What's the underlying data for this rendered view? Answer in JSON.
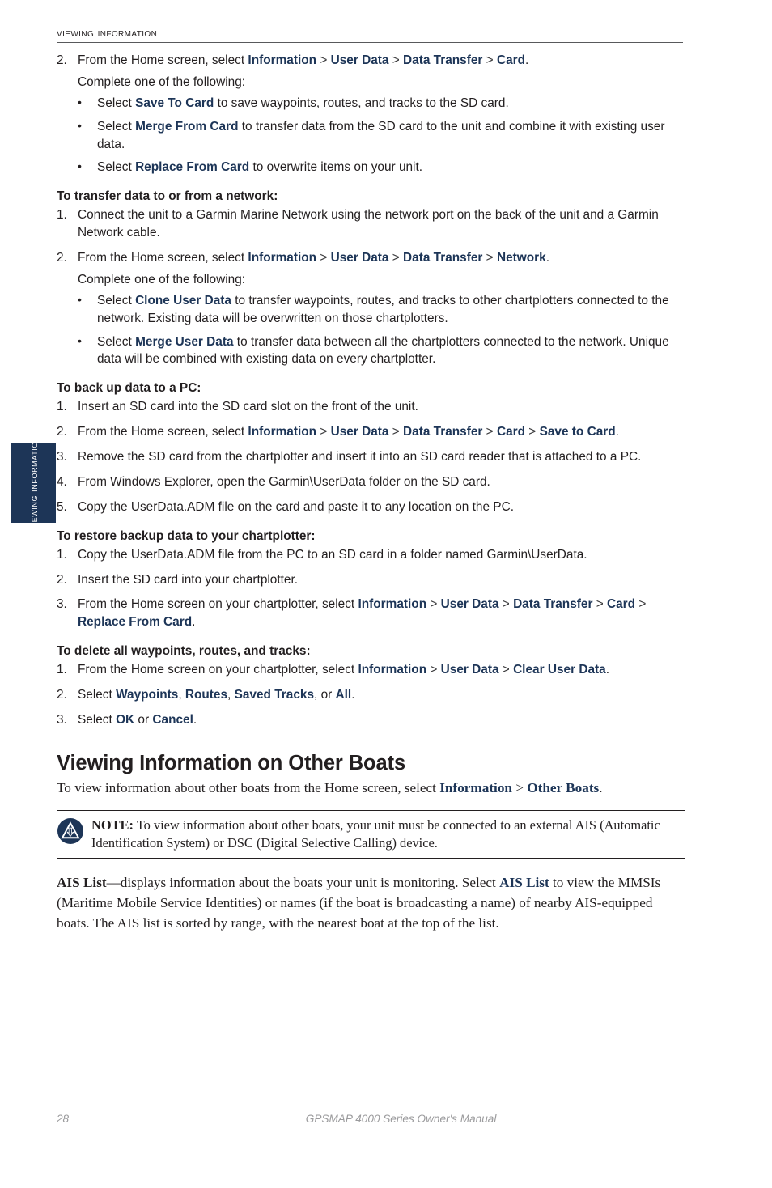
{
  "page": {
    "header_title": "Viewing Information",
    "side_tab_label": "Viewing Information",
    "footer_page_number": "28",
    "footer_manual_title": "GPSMAP 4000 Series Owner's Manual",
    "accent_navy": "#1d3557",
    "text_color": "#231f20",
    "footer_color": "#9a9a9c"
  },
  "sections": {
    "card_transfer": {
      "step2": {
        "num": "2.",
        "lead": "From the Home screen, select ",
        "term1": "Information",
        "sep": " > ",
        "term2": "User Data",
        "term3": "Data Transfer",
        "term4": "Card",
        "end": "."
      },
      "complete_line": "Complete one of the following:",
      "bullets": [
        {
          "dot": "•",
          "lead": "Select ",
          "term": "Save To Card",
          "tail": " to save waypoints, routes, and tracks to the SD card."
        },
        {
          "dot": "•",
          "lead": "Select ",
          "term": "Merge From Card",
          "tail": " to transfer data from the SD card to the unit and combine it with existing user data."
        },
        {
          "dot": "•",
          "lead": "Select ",
          "term": "Replace From Card",
          "tail": " to overwrite items on your unit."
        }
      ]
    },
    "network_transfer": {
      "heading": "To transfer data to or from a network:",
      "step1": {
        "num": "1.",
        "text": "Connect the unit to a Garmin Marine Network using the network port on the back of the unit and a Garmin Network cable."
      },
      "step2": {
        "num": "2.",
        "lead": "From the Home screen, select ",
        "term1": "Information",
        "term2": "User Data",
        "term3": "Data Transfer",
        "term4": "Network",
        "end": "."
      },
      "complete_line": "Complete one of the following:",
      "bullets": [
        {
          "dot": "•",
          "lead": "Select ",
          "term": "Clone User Data",
          "tail": " to transfer waypoints, routes, and tracks to other chartplotters connected to the network. Existing data will be overwritten on those chartplotters."
        },
        {
          "dot": "•",
          "lead": "Select ",
          "term": "Merge User Data",
          "tail": " to transfer data between all the chartplotters connected to the network. Unique data will be combined with existing data on every chartplotter."
        }
      ]
    },
    "backup_pc": {
      "heading": "To back up data to a PC:",
      "steps": [
        {
          "num": "1.",
          "text": "Insert an SD card into the SD card slot on the front of the unit."
        },
        {
          "num": "2.",
          "lead": "From the Home screen, select ",
          "term1": "Information",
          "term2": "User Data",
          "term3": "Data Transfer",
          "term4": "Card",
          "term5": "Save to Card",
          "end": "."
        },
        {
          "num": "3.",
          "text": "Remove the SD card from the chartplotter and insert it into an SD card reader that is attached to a PC."
        },
        {
          "num": "4.",
          "text": "From Windows Explorer, open the Garmin\\UserData folder on the SD card."
        },
        {
          "num": "5.",
          "text": "Copy the UserData.ADM file on the card and paste it to any location on the PC."
        }
      ]
    },
    "restore_backup": {
      "heading": "To restore backup data to your chartplotter:",
      "steps": [
        {
          "num": "1.",
          "text": "Copy the UserData.ADM file from the PC to an SD card in a folder named Garmin\\UserData."
        },
        {
          "num": "2.",
          "text": "Insert the SD card into your chartplotter."
        },
        {
          "num": "3.",
          "lead": "From the Home screen on your chartplotter, select ",
          "term1": "Information",
          "term2": "User Data",
          "term3": "Data Transfer",
          "term4": "Card",
          "term5": "Replace From Card",
          "end": "."
        }
      ]
    },
    "delete_all": {
      "heading": "To delete all waypoints, routes, and tracks:",
      "step1": {
        "num": "1.",
        "lead": "From the Home screen on your chartplotter, select ",
        "term1": "Information",
        "term2": "User Data",
        "term3": "Clear User Data",
        "end": "."
      },
      "step2": {
        "num": "2.",
        "lead": "Select ",
        "term1": "Waypoints",
        "comma1": ", ",
        "term2": "Routes",
        "comma2": ", ",
        "term3": "Saved Tracks",
        "or": ", or ",
        "term4": "All",
        "end": "."
      },
      "step3": {
        "num": "3.",
        "lead": "Select ",
        "term1": "OK",
        "or": " or ",
        "term2": "Cancel",
        "end": "."
      }
    },
    "other_boats": {
      "heading": "Viewing Information on Other Boats",
      "intro_lead": "To view information about other boats from the Home screen, select ",
      "intro_term1": "Information",
      "intro_sep": " > ",
      "intro_term2": "Other Boats",
      "intro_end": ".",
      "note": {
        "icon": "garmin-note-icon",
        "label": "NOTE:",
        "text": " To view information about other boats, your unit must be connected to an external AIS (Automatic Identification System) or DSC (Digital Selective Calling) device."
      },
      "ais_list": {
        "term_bold": "AIS List",
        "mid": "—displays information about the boats your unit is monitoring. Select ",
        "term_navy": "AIS List",
        "tail": " to view the MMSIs (Maritime Mobile Service Identities) or names (if the boat is broadcasting a name) of nearby AIS-equipped boats. The AIS list is sorted by range, with the nearest boat at the top of the list."
      }
    }
  }
}
